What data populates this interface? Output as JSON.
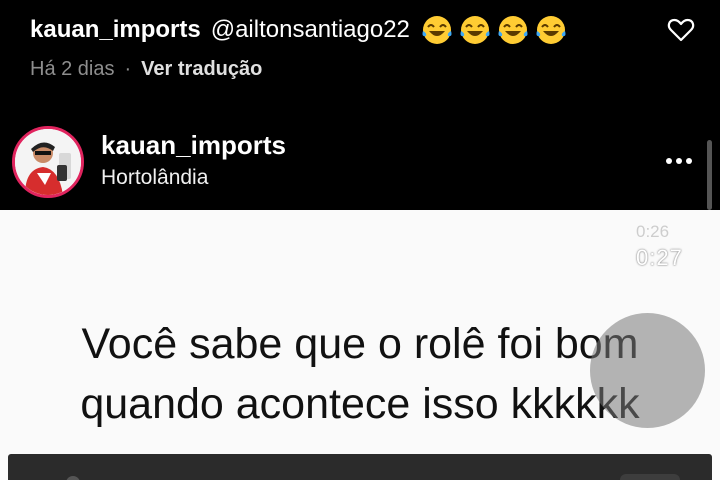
{
  "comment": {
    "username": "kauan_imports",
    "text": "@ailtonsantiago22",
    "emojis": [
      "laughing-tears-emoji",
      "laughing-tears-emoji",
      "laughing-tears-emoji",
      "laughing-tears-emoji"
    ],
    "time": "Há 2 dias",
    "separator": "·",
    "translate_label": "Ver tradução",
    "like_icon": "heart-outline-icon"
  },
  "post": {
    "username": "kauan_imports",
    "location": "Hortolândia",
    "avatar_ring_color": "#e0245e",
    "more_icon": "more-horizontal-icon"
  },
  "video": {
    "timer_faded": "0:26",
    "timer": "0:27",
    "caption_line1": "Você sabe que o rolê foi bom",
    "caption_line2": "quando acontece isso kkkkkk",
    "background_color": "#fafafa"
  }
}
